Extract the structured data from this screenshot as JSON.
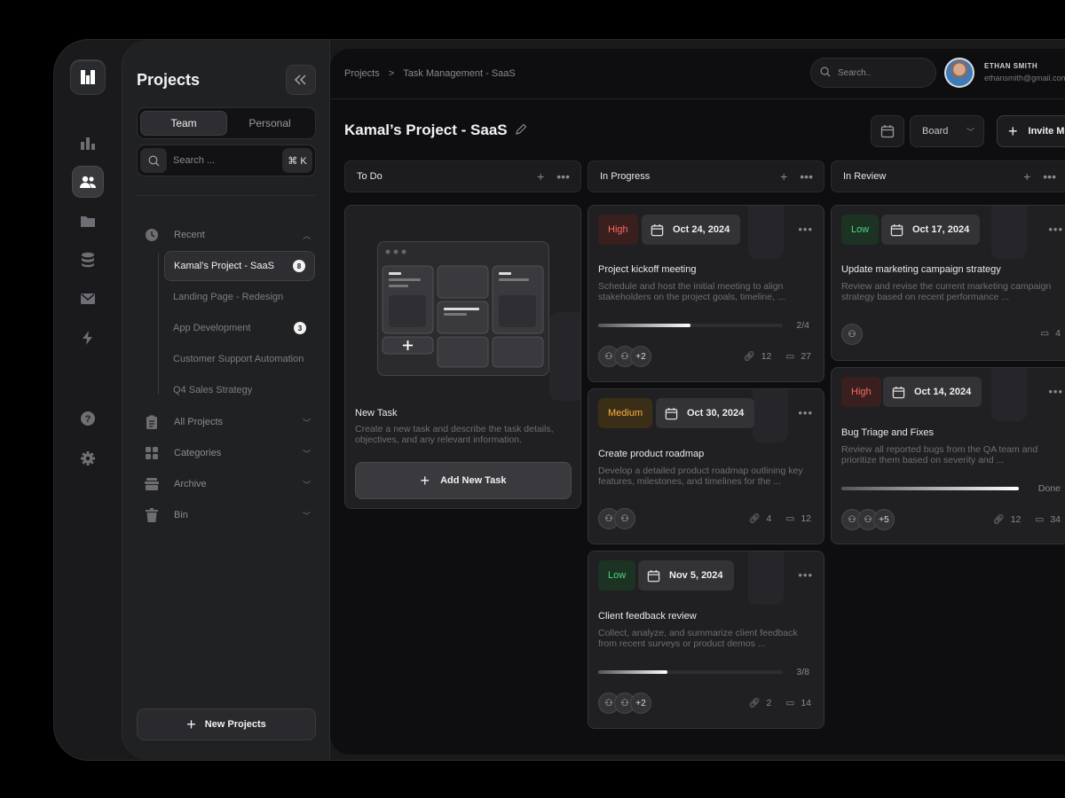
{
  "sidebar": {
    "title": "Projects",
    "segments": [
      "Team",
      "Personal"
    ],
    "search_placeholder": "Search ...",
    "search_shortcut": "⌘ K",
    "recent_label": "Recent",
    "recent_items": [
      {
        "label": "Kamal’s Project - SaaS",
        "badge": "8",
        "active": true
      },
      {
        "label": "Landing Page - Redesign",
        "badge": ""
      },
      {
        "label": "App Development",
        "badge": "3"
      },
      {
        "label": "Customer Support Automation",
        "badge": ""
      },
      {
        "label": "Q4 Sales Strategy",
        "badge": ""
      }
    ],
    "sections": [
      "All Projects",
      "Categories",
      "Archive",
      "Bin"
    ],
    "new_button": "New Projects"
  },
  "header": {
    "breadcrumb": [
      "Projects",
      ">",
      "Task Management - SaaS"
    ],
    "search_placeholder": "Search..",
    "user_name": "ETHAN SMITH",
    "user_email": "ethansmith@gmail.com"
  },
  "page": {
    "title": "Kamal’s Project - SaaS",
    "view_select": "Board",
    "invite_button": "Invite Me"
  },
  "columns": [
    {
      "title": "To Do"
    },
    {
      "title": "In Progress"
    },
    {
      "title": "In Review"
    }
  ],
  "todo_card": {
    "title": "New Task",
    "description": "Create a new task and describe the task details, objectives, and any relevant information.",
    "button": "Add New Task"
  },
  "cards": [
    {
      "priority": "High",
      "date": "Oct 24, 2024",
      "title": "Project kickoff meeting",
      "description": "Schedule and host the initial meeting to align stakeholders on the project goals, timeline, ...",
      "progress_label": "2/4",
      "progress": 0.5,
      "more_members": "+2",
      "links": "12",
      "comments": "27"
    },
    {
      "priority": "Medium",
      "date": "Oct 30, 2024",
      "title": "Create product roadmap",
      "description": "Develop a detailed product roadmap outlining key features, milestones, and timelines for the ...",
      "links": "4",
      "comments": "12"
    },
    {
      "priority": "Low",
      "date": "Nov 5, 2024",
      "title": "Client feedback review",
      "description": "Collect, analyze, and summarize client feedback from recent surveys or product demos ...",
      "progress_label": "3/8",
      "progress": 0.375,
      "more_members": "+2",
      "links": "2",
      "comments": "14"
    },
    {
      "priority": "Low",
      "date": "Oct 17, 2024",
      "title": "Update marketing campaign strategy",
      "description": "Review and revise the current marketing campaign strategy based on recent performance ...",
      "comments": "4"
    },
    {
      "priority": "High",
      "date": "Oct 14, 2024",
      "title": "Bug Triage and Fixes",
      "description": "Review all reported bugs from the QA team and prioritize them based on severity and ...",
      "progress_label": "Done",
      "progress": 1,
      "more_members": "+5",
      "links": "12",
      "comments": "34"
    }
  ],
  "colors": {
    "accent": "#ffffff",
    "high": "#ff6a5f",
    "medium": "#ffb13d",
    "low": "#4fd57d",
    "background": "#0e0e10"
  }
}
